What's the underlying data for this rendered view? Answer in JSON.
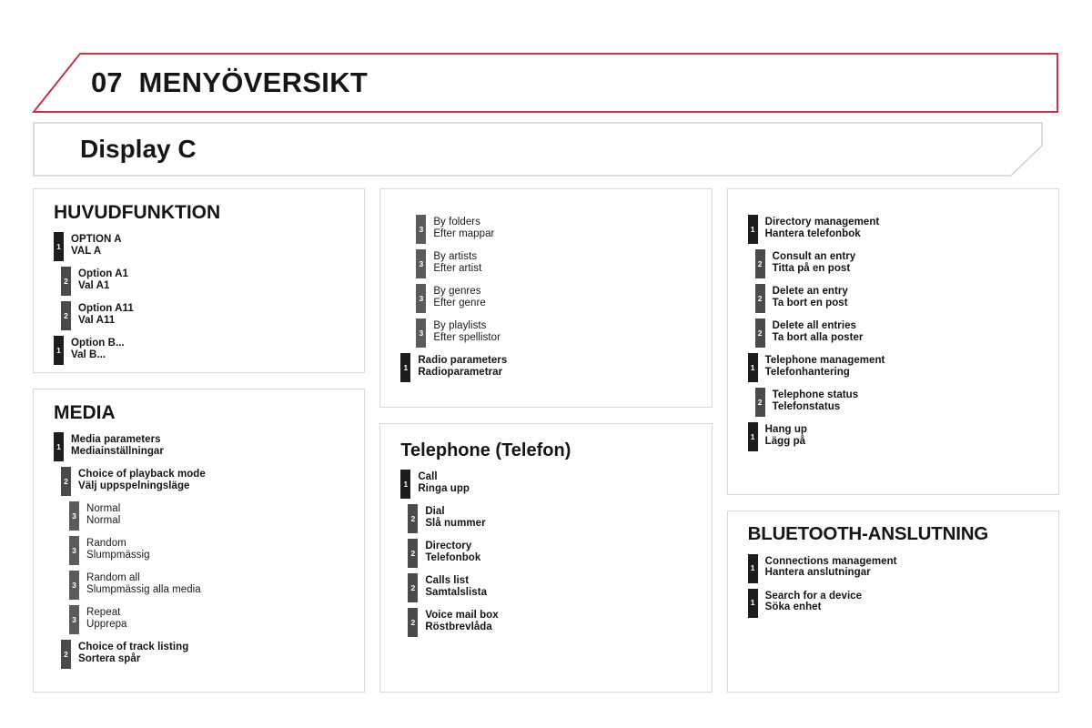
{
  "header": {
    "chapter_number": "07",
    "chapter_title": "MENYÖVERSIKT",
    "subtitle": "Display C",
    "accent_color": "#c8324a",
    "border_color": "#d8d8d8"
  },
  "panels": {
    "huvudfunktion": {
      "title": "HUVUDFUNKTION",
      "entries": [
        {
          "level": 1,
          "en": "OPTION A",
          "sv": "VAL A"
        },
        {
          "level": 2,
          "en": "Option A1",
          "sv": "Val A1"
        },
        {
          "level": 2,
          "en": "Option A11",
          "sv": "Val A11"
        },
        {
          "level": 1,
          "en": "Option B...",
          "sv": "Val B..."
        }
      ]
    },
    "media": {
      "title": "MEDIA",
      "entries": [
        {
          "level": 1,
          "en": "Media parameters",
          "sv": "Mediainställningar"
        },
        {
          "level": 2,
          "en": "Choice of playback mode",
          "sv": "Välj uppspelningsläge"
        },
        {
          "level": 3,
          "en": "Normal",
          "sv": "Normal"
        },
        {
          "level": 3,
          "en": "Random",
          "sv": "Slumpmässig"
        },
        {
          "level": 3,
          "en": "Random all",
          "sv": "Slumpmässig alla media"
        },
        {
          "level": 3,
          "en": "Repeat",
          "sv": "Upprepa"
        },
        {
          "level": 2,
          "en": "Choice of track listing",
          "sv": "Sortera spår"
        }
      ]
    },
    "media_continued": {
      "title": "",
      "entries": [
        {
          "level": 3,
          "en": "By folders",
          "sv": "Efter mappar"
        },
        {
          "level": 3,
          "en": "By artists",
          "sv": "Efter artist"
        },
        {
          "level": 3,
          "en": "By genres",
          "sv": "Efter genre"
        },
        {
          "level": 3,
          "en": "By playlists",
          "sv": "Efter spellistor"
        },
        {
          "level": 1,
          "en": "Radio parameters",
          "sv": "Radioparametrar"
        }
      ]
    },
    "telephone": {
      "title": "Telephone (Telefon)",
      "entries": [
        {
          "level": 1,
          "en": "Call",
          "sv": "Ringa upp"
        },
        {
          "level": 2,
          "en": "Dial",
          "sv": "Slå nummer"
        },
        {
          "level": 2,
          "en": "Directory",
          "sv": "Telefonbok"
        },
        {
          "level": 2,
          "en": "Calls list",
          "sv": "Samtalslista"
        },
        {
          "level": 2,
          "en": "Voice mail box",
          "sv": "Röstbrevlåda"
        }
      ]
    },
    "directory": {
      "title": "",
      "entries": [
        {
          "level": 1,
          "en": "Directory management",
          "sv": "Hantera telefonbok"
        },
        {
          "level": 2,
          "en": "Consult an entry",
          "sv": "Titta på en post"
        },
        {
          "level": 2,
          "en": "Delete an entry",
          "sv": "Ta bort en post"
        },
        {
          "level": 2,
          "en": "Delete all entries",
          "sv": "Ta bort alla poster"
        },
        {
          "level": 1,
          "en": "Telephone management",
          "sv": "Telefonhantering"
        },
        {
          "level": 2,
          "en": "Telephone status",
          "sv": "Telefonstatus"
        },
        {
          "level": 1,
          "en": "Hang up",
          "sv": "Lägg på"
        }
      ]
    },
    "bluetooth": {
      "title": "BLUETOOTH-ANSLUTNING",
      "entries": [
        {
          "level": 1,
          "en": "Connections management",
          "sv": "Hantera anslutningar"
        },
        {
          "level": 1,
          "en": "Search for a device",
          "sv": "Söka enhet"
        }
      ]
    }
  }
}
